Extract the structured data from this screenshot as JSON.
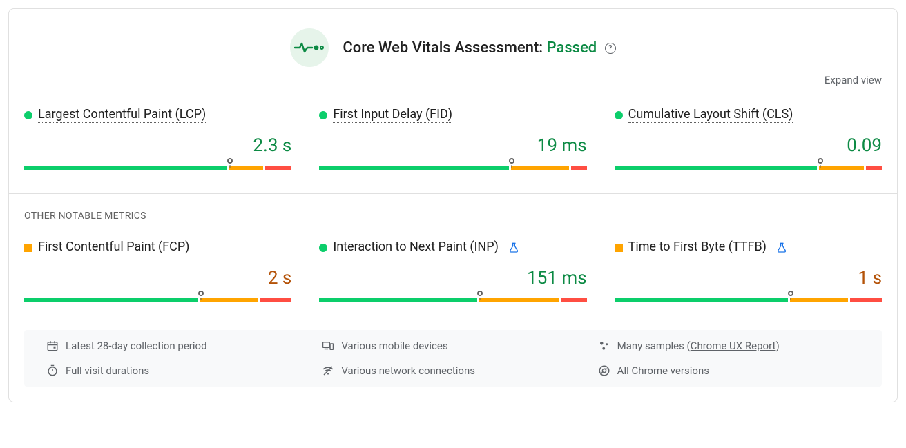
{
  "header": {
    "title_prefix": "Core Web Vitals Assessment: ",
    "status": "Passed"
  },
  "expand_link": "Expand view",
  "core_metrics": [
    {
      "name": "Largest Contentful Paint (LCP)",
      "value": "2.3 s",
      "status": "green",
      "marker_pct": 77,
      "segs": [
        77,
        13,
        10
      ],
      "flask": false
    },
    {
      "name": "First Input Delay (FID)",
      "value": "19 ms",
      "status": "green",
      "marker_pct": 72,
      "segs": [
        72,
        22,
        6
      ],
      "flask": false
    },
    {
      "name": "Cumulative Layout Shift (CLS)",
      "value": "0.09",
      "status": "green",
      "marker_pct": 77,
      "segs": [
        77,
        17,
        6
      ],
      "flask": false
    }
  ],
  "other_label": "OTHER NOTABLE METRICS",
  "other_metrics": [
    {
      "name": "First Contentful Paint (FCP)",
      "value": "2 s",
      "status": "orange",
      "marker_pct": 66,
      "segs": [
        66,
        22,
        12
      ],
      "flask": false
    },
    {
      "name": "Interaction to Next Paint (INP)",
      "value": "151 ms",
      "status": "green",
      "marker_pct": 60,
      "segs": [
        60,
        30,
        10
      ],
      "flask": true
    },
    {
      "name": "Time to First Byte (TTFB)",
      "value": "1 s",
      "status": "orange",
      "marker_pct": 66,
      "segs": [
        66,
        22,
        12
      ],
      "flask": true
    }
  ],
  "footer": {
    "row1": [
      {
        "icon": "calendar",
        "text": "Latest 28-day collection period"
      },
      {
        "icon": "devices",
        "text": "Various mobile devices"
      },
      {
        "icon": "samples",
        "text_prefix": "Many samples (",
        "link": "Chrome UX Report",
        "text_suffix": ")"
      }
    ],
    "row2": [
      {
        "icon": "timer",
        "text": "Full visit durations"
      },
      {
        "icon": "network",
        "text": "Various network connections"
      },
      {
        "icon": "chrome",
        "text": "All Chrome versions"
      }
    ]
  }
}
